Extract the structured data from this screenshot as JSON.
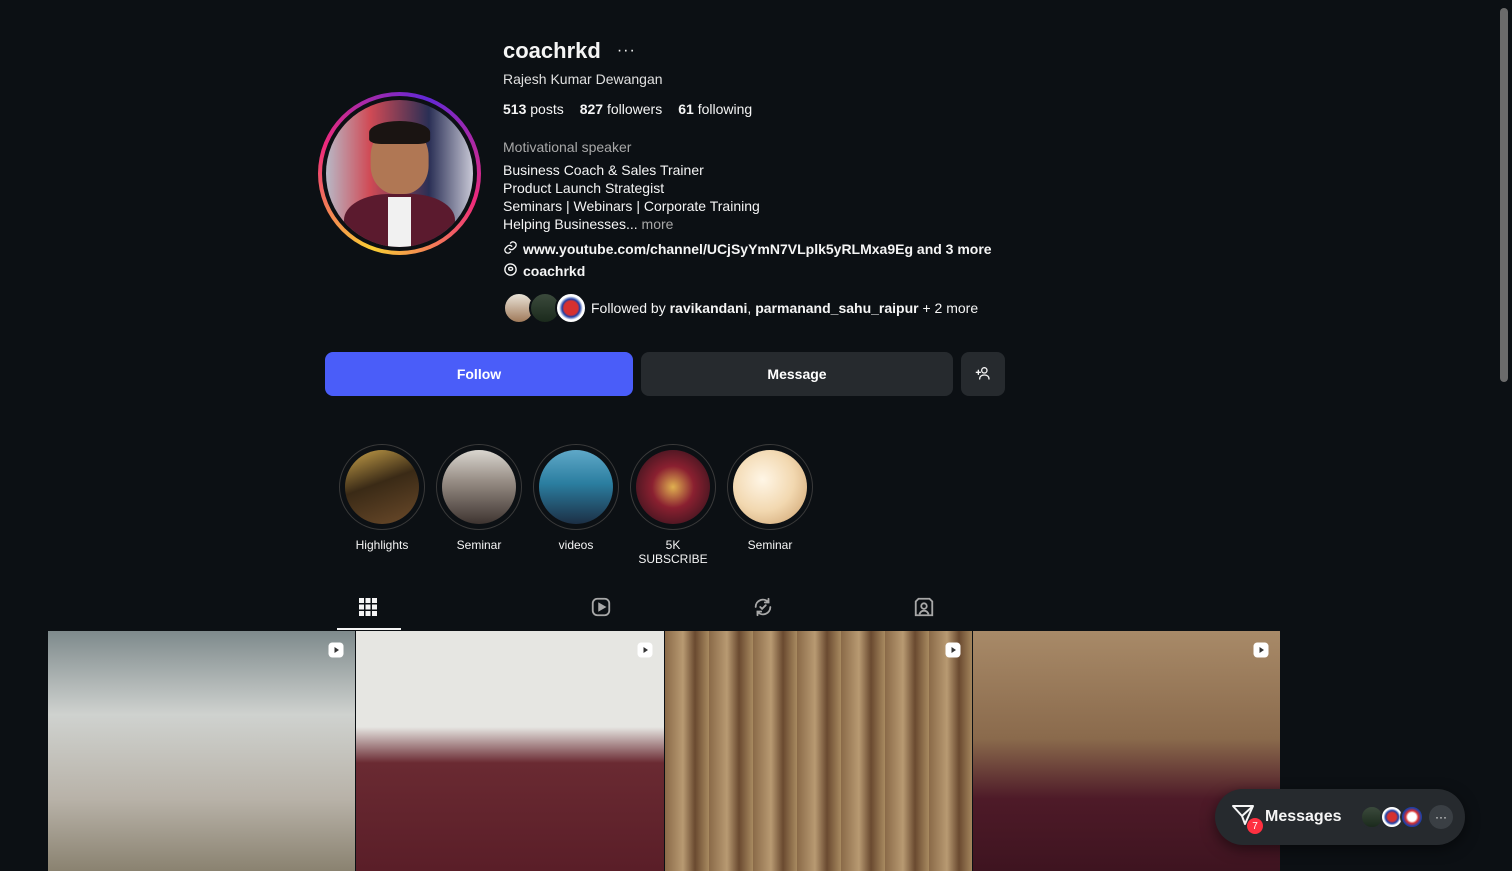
{
  "profile": {
    "username": "coachrkd",
    "more_icon": "···",
    "full_name": "Rajesh Kumar Dewangan",
    "posts_count": "513",
    "posts_label": "posts",
    "followers_count": "827",
    "followers_label": "followers",
    "following_count": "61",
    "following_label": "following",
    "category": "Motivational speaker",
    "bio_lines": [
      "Business Coach & Sales Trainer",
      "Product Launch Strategist",
      "Seminars | Webinars | Corporate Training",
      "Helping Businesses..."
    ],
    "bio_more": "more",
    "link_text": "www.youtube.com/channel/UCjSyYmN7VLplk5yRLMxa9Eg and 3 more",
    "threads_handle": "coachrkd",
    "followed_by_prefix": "Followed by",
    "followed_by_user1": "ravikandani",
    "followed_by_sep": ",",
    "followed_by_user2": "parmanand_sahu_raipur",
    "followed_by_suffix": "+ 2 more"
  },
  "actions": {
    "follow_label": "Follow",
    "message_label": "Message"
  },
  "highlights": [
    {
      "label": "Highlights"
    },
    {
      "label": "Seminar"
    },
    {
      "label": "videos"
    },
    {
      "label": "5K SUBSCRIBE"
    },
    {
      "label": "Seminar"
    }
  ],
  "tabs": [
    "grid-icon",
    "reels-icon",
    "reposts-icon",
    "tagged-icon"
  ],
  "messages_widget": {
    "label": "Messages",
    "badge": "7",
    "more": "···"
  },
  "colors": {
    "background": "#0c1014",
    "follow_button": "#4a5df9",
    "secondary_button": "#262a2e",
    "notification_badge": "#ff3040"
  }
}
